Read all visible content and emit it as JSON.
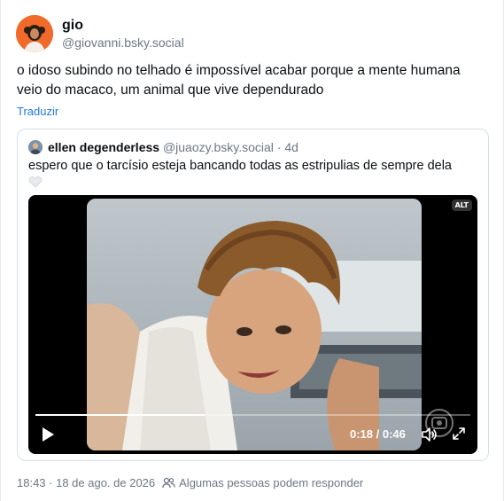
{
  "author": {
    "display_name": "gio",
    "handle": "@giovanni.bsky.social"
  },
  "post": {
    "text": "o idoso subindo no telhado é impossível acabar porque a mente humana veio do macaco, um animal que vive dependurado",
    "translate_label": "Traduzir"
  },
  "quote": {
    "display_name": "ellen degenderless",
    "handle": "@juaozy.bsky.social",
    "separator": " · ",
    "age": "4d",
    "text": "espero que o tarcísio esteja bancando todas as estripulias de sempre dela",
    "video": {
      "alt_badge": "ALT",
      "time": "0:18 / 0:46",
      "progress": 0.39
    }
  },
  "footer": {
    "timestamp": "18:43 · 18 de ago. de 2026",
    "reply_note": "Algumas pessoas podem responder"
  },
  "icons": {
    "heart": "heart-outline-icon",
    "play": "play-icon",
    "volume": "volume-icon",
    "fullscreen": "fullscreen-icon",
    "people": "people-icon"
  },
  "colors": {
    "avatar_bg": "#f26a2a",
    "link": "#1f7ae0",
    "muted": "#6b7785"
  }
}
